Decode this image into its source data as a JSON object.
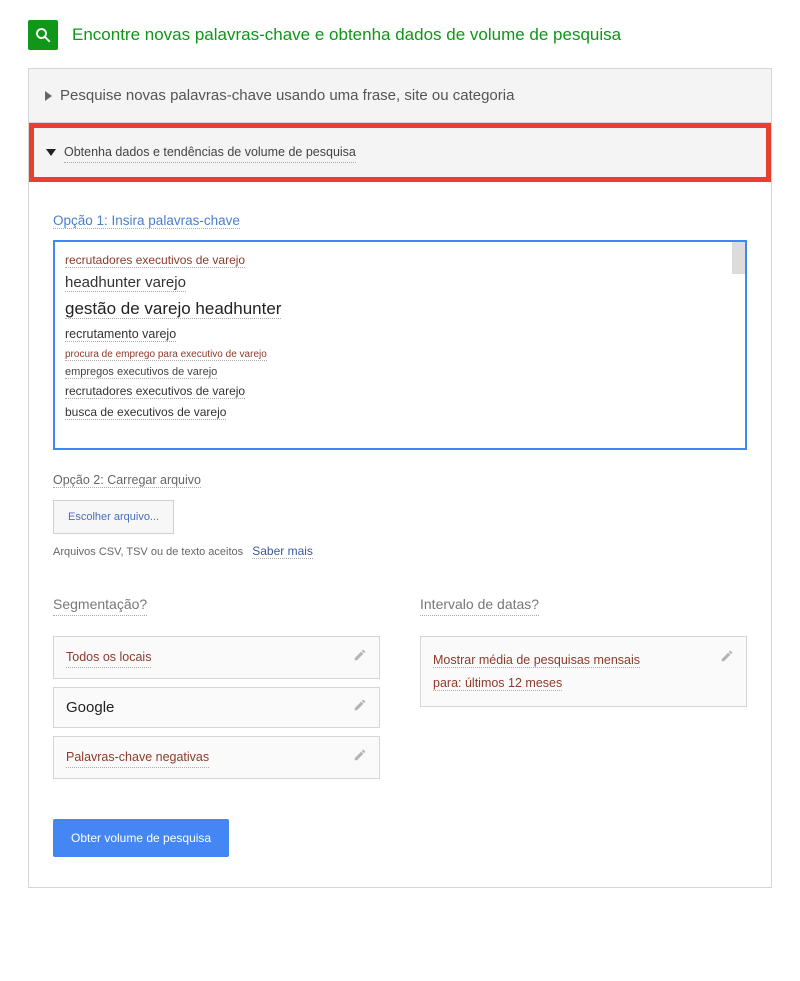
{
  "header": {
    "title": "Encontre novas palavras-chave e obtenha dados de volume de pesquisa"
  },
  "accordion": {
    "search_phrase": "Pesquise novas palavras-chave usando uma frase, site ou categoria",
    "get_data": "Obtenha dados e tendências de volume de pesquisa"
  },
  "option1": {
    "label": "Opção 1: Insira palavras-chave",
    "keywords": [
      "recrutadores executivos de varejo",
      "headhunter varejo",
      "gestão de varejo headhunter",
      "recrutamento varejo",
      "procura de emprego para executivo de varejo",
      "empregos executivos de varejo",
      "recrutadores executivos de varejo",
      "busca de executivos de varejo"
    ]
  },
  "option2": {
    "label": "Opção 2: Carregar arquivo",
    "button": "Escolher arquivo...",
    "hint": "Arquivos CSV, TSV ou de texto aceitos",
    "learn_more": "Saber mais"
  },
  "targeting": {
    "header": "Segmentação?",
    "locations": "Todos os locais",
    "google": "Google",
    "negative": "Palavras-chave negativas"
  },
  "date_range": {
    "header": "Intervalo de datas?",
    "line1": "Mostrar média de pesquisas mensais",
    "line2": "para: últimos 12 meses"
  },
  "submit": {
    "label": "Obter volume de pesquisa"
  }
}
